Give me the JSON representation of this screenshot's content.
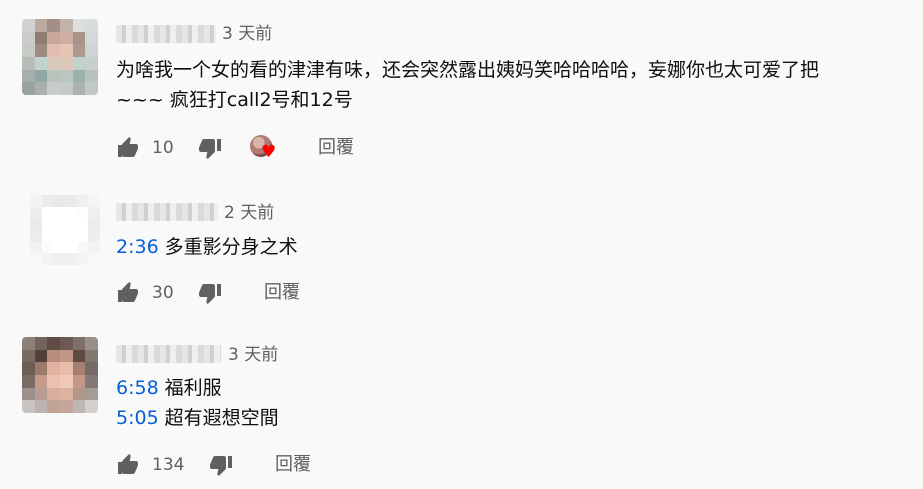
{
  "icons": {
    "like": "thumb-up-icon",
    "dislike": "thumb-down-icon",
    "heart": "heart-icon"
  },
  "colors": {
    "timestamp_link": "#065fd4",
    "meta_gray": "#606060",
    "heart_red": "#ff0000"
  },
  "comments": [
    {
      "time": "3 天前",
      "lines": [
        {
          "text": "为啥我一个女的看的津津有味，还会突然露出姨妈笑哈哈哈哈，妄娜你也太可爱了把"
        },
        {
          "text": "~~~ 疯狂打call2号和12号"
        }
      ],
      "likes": "10",
      "reply_label": "回覆",
      "creator_heart": true
    },
    {
      "time": "2 天前",
      "lines": [
        {
          "timestamp": "2:36",
          "text": "多重影分身之术"
        }
      ],
      "likes": "30",
      "reply_label": "回覆"
    },
    {
      "time": "3 天前",
      "lines": [
        {
          "timestamp": "6:58",
          "text": "福利服"
        },
        {
          "timestamp": "5:05",
          "text": "超有遐想空間"
        }
      ],
      "likes": "134",
      "reply_label": "回覆"
    }
  ]
}
